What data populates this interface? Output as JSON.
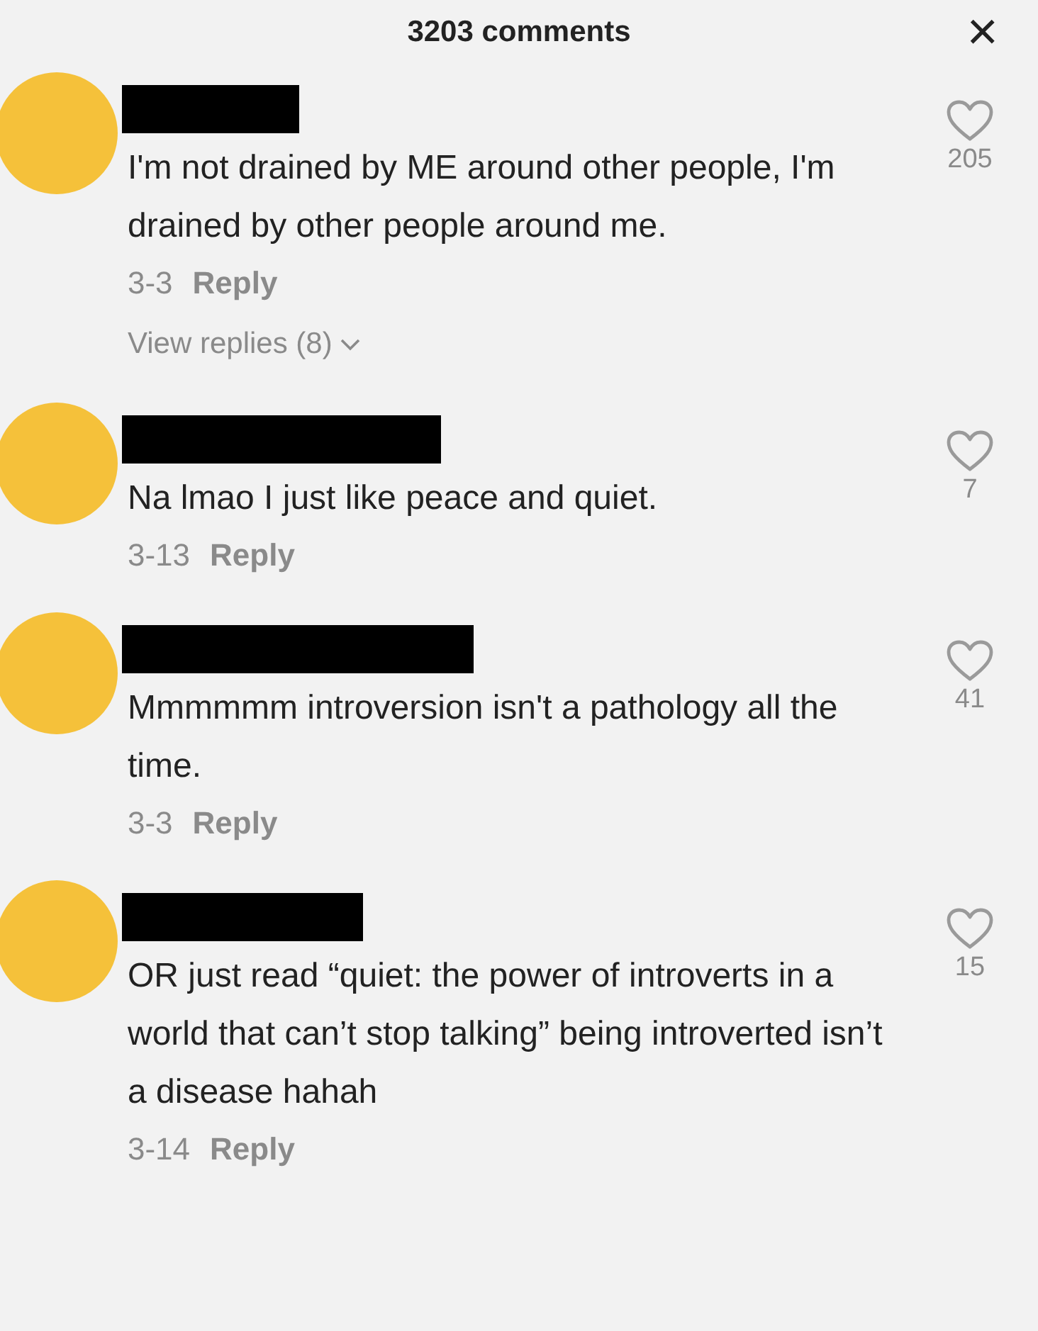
{
  "header": {
    "title": "3203 comments",
    "close": "×"
  },
  "comments": [
    {
      "text": "I'm not drained by ME around other people, I'm drained by other people around me.",
      "date": "3-3",
      "reply": "Reply",
      "likes": "205",
      "replies": "View replies (8)"
    },
    {
      "text": "Na lmao I just like peace and quiet.",
      "date": "3-13",
      "reply": "Reply",
      "likes": "7"
    },
    {
      "text": "Mmmmmm introversion isn't a pathology all the time.",
      "date": "3-3",
      "reply": "Reply",
      "likes": "41"
    },
    {
      "text": "OR just read “quiet: the power of introverts in a world that can’t stop talking” being introverted isn’t a disease hahah",
      "date": "3-14",
      "reply": "Reply",
      "likes": "15"
    }
  ]
}
